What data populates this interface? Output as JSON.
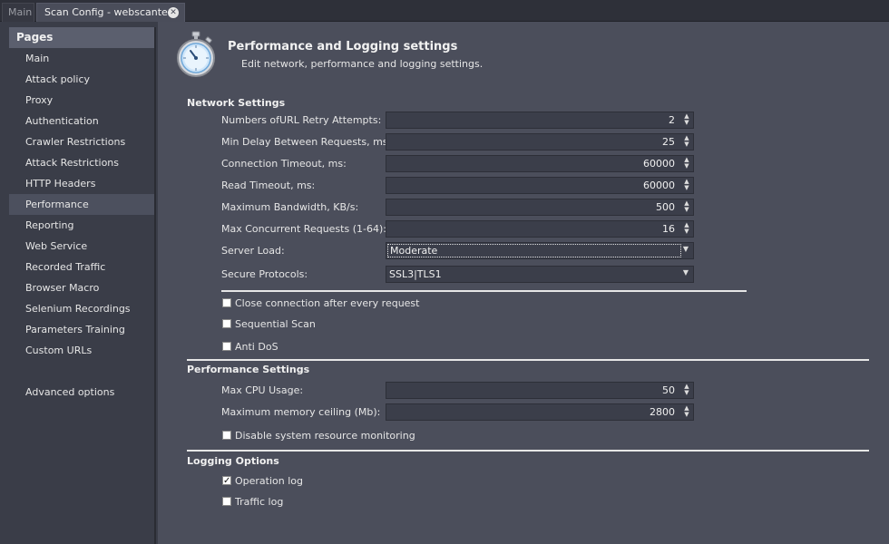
{
  "tabs": [
    {
      "label": "Main",
      "active": false
    },
    {
      "label": "Scan Config - webscantest",
      "active": true
    }
  ],
  "sidebar": {
    "header": "Pages",
    "items": [
      {
        "label": "Main"
      },
      {
        "label": "Attack policy"
      },
      {
        "label": "Proxy"
      },
      {
        "label": "Authentication"
      },
      {
        "label": "Crawler Restrictions"
      },
      {
        "label": "Attack Restrictions"
      },
      {
        "label": "HTTP Headers"
      },
      {
        "label": "Performance",
        "selected": true
      },
      {
        "label": "Reporting"
      },
      {
        "label": "Web Service"
      },
      {
        "label": "Recorded Traffic"
      },
      {
        "label": "Browser Macro"
      },
      {
        "label": "Selenium Recordings"
      },
      {
        "label": "Parameters Training"
      },
      {
        "label": "Custom URLs"
      }
    ],
    "advanced": "Advanced options"
  },
  "header": {
    "icon": "stopwatch-icon",
    "title": "Performance and Logging settings",
    "subtitle": "Edit network, performance and logging settings."
  },
  "network": {
    "title": "Network Settings",
    "retry_label": "Numbers ofURL Retry Attempts:",
    "retry_value": "2",
    "delay_label": "Min Delay Between Requests, ms:",
    "delay_value": "25",
    "conn_timeout_label": "Connection Timeout, ms:",
    "conn_timeout_value": "60000",
    "read_timeout_label": "Read Timeout, ms:",
    "read_timeout_value": "60000",
    "bandwidth_label": "Maximum Bandwidth, KB/s:",
    "bandwidth_value": "500",
    "concurrent_label": "Max Concurrent Requests (1-64):",
    "concurrent_value": "16",
    "server_load_label": "Server Load:",
    "server_load_value": "Moderate",
    "protocols_label": "Secure Protocols:",
    "protocols_value": "SSL3|TLS1",
    "close_conn_label": "Close connection after every request",
    "close_conn_checked": false,
    "sequential_label": "Sequential Scan",
    "sequential_checked": false,
    "antidos_label": "Anti DoS",
    "antidos_checked": false
  },
  "performance": {
    "title": "Performance Settings",
    "cpu_label": "Max CPU Usage:",
    "cpu_value": "50",
    "memory_label": "Maximum memory ceiling (Mb):",
    "memory_value": "2800",
    "disable_monitor_label": "Disable system resource monitoring",
    "disable_monitor_checked": false
  },
  "logging": {
    "title": "Logging Options",
    "operation_label": "Operation log",
    "operation_checked": true,
    "traffic_label": "Traffic log",
    "traffic_checked": false
  },
  "colors": {
    "panel_bg": "#4b4e5b",
    "sidebar_bg": "#3a3d48",
    "sidebar_header": "#5b5f6e",
    "input_bg": "#3b3e4a"
  }
}
